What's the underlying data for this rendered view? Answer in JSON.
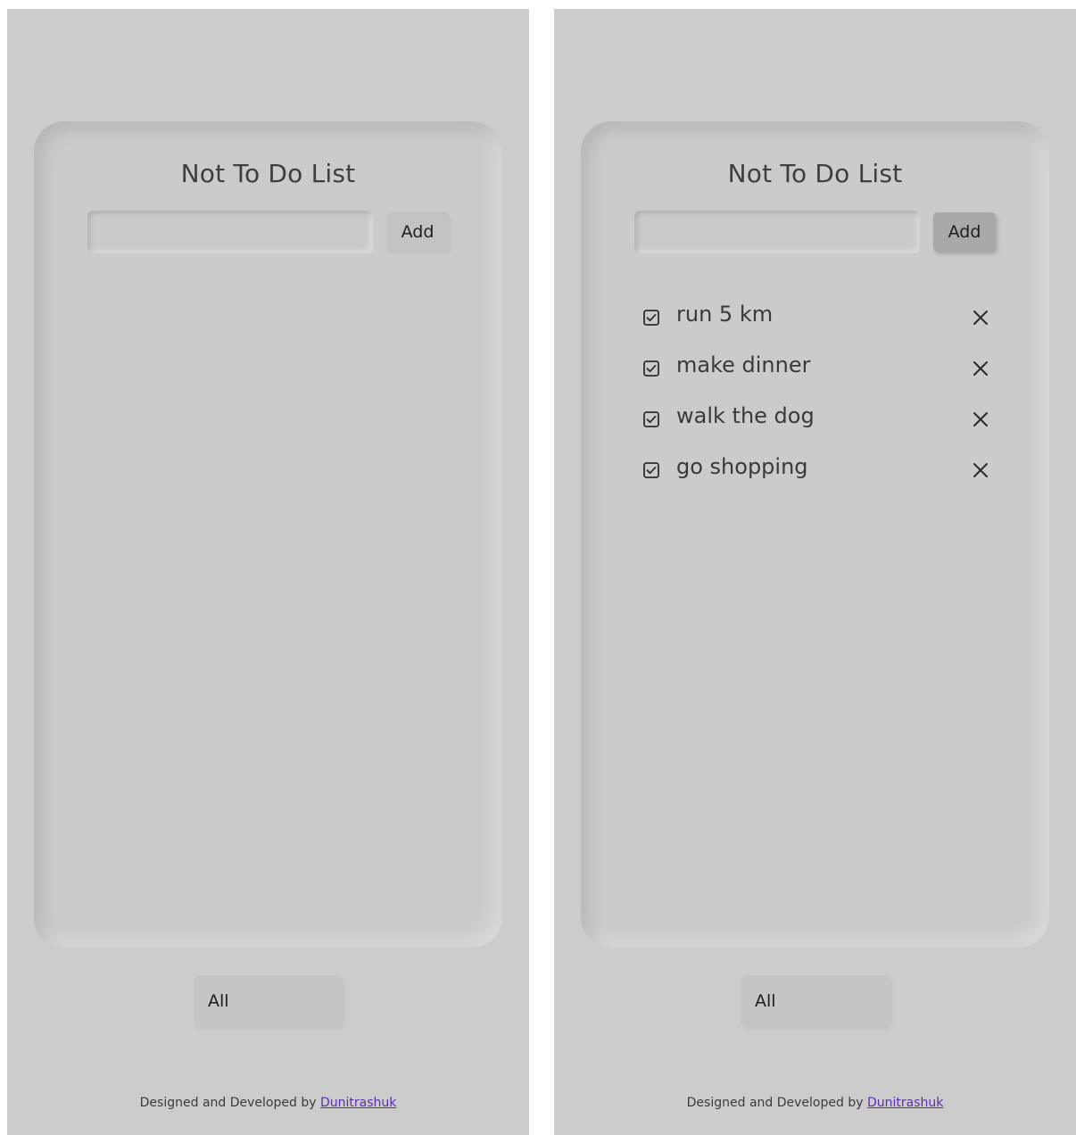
{
  "colors": {
    "page_bg": "#cccccc",
    "link": "#5b2fb3",
    "add_active": "#a9a9a9"
  },
  "screens": [
    {
      "title": "Not To Do List",
      "input": {
        "value": "",
        "placeholder": ""
      },
      "add_label": "Add",
      "tasks": [],
      "filter": {
        "selected": "All"
      },
      "footer": {
        "text": "Designed and Developed by ",
        "link": "Dunitrashuk"
      }
    },
    {
      "title": "Not To Do List",
      "input": {
        "value": "",
        "placeholder": ""
      },
      "add_label": "Add",
      "tasks": [
        {
          "text": "run 5 km",
          "checked": true,
          "check_icon": "checkbox-checked-icon",
          "delete_icon": "close-icon"
        },
        {
          "text": "make dinner",
          "checked": true,
          "check_icon": "checkbox-checked-icon",
          "delete_icon": "close-icon"
        },
        {
          "text": "walk the dog",
          "checked": true,
          "check_icon": "checkbox-checked-icon",
          "delete_icon": "close-icon"
        },
        {
          "text": "go shopping",
          "checked": true,
          "check_icon": "checkbox-checked-icon",
          "delete_icon": "close-icon"
        }
      ],
      "filter": {
        "selected": "All"
      },
      "footer": {
        "text": "Designed and Developed by ",
        "link": "Dunitrashuk"
      }
    }
  ]
}
